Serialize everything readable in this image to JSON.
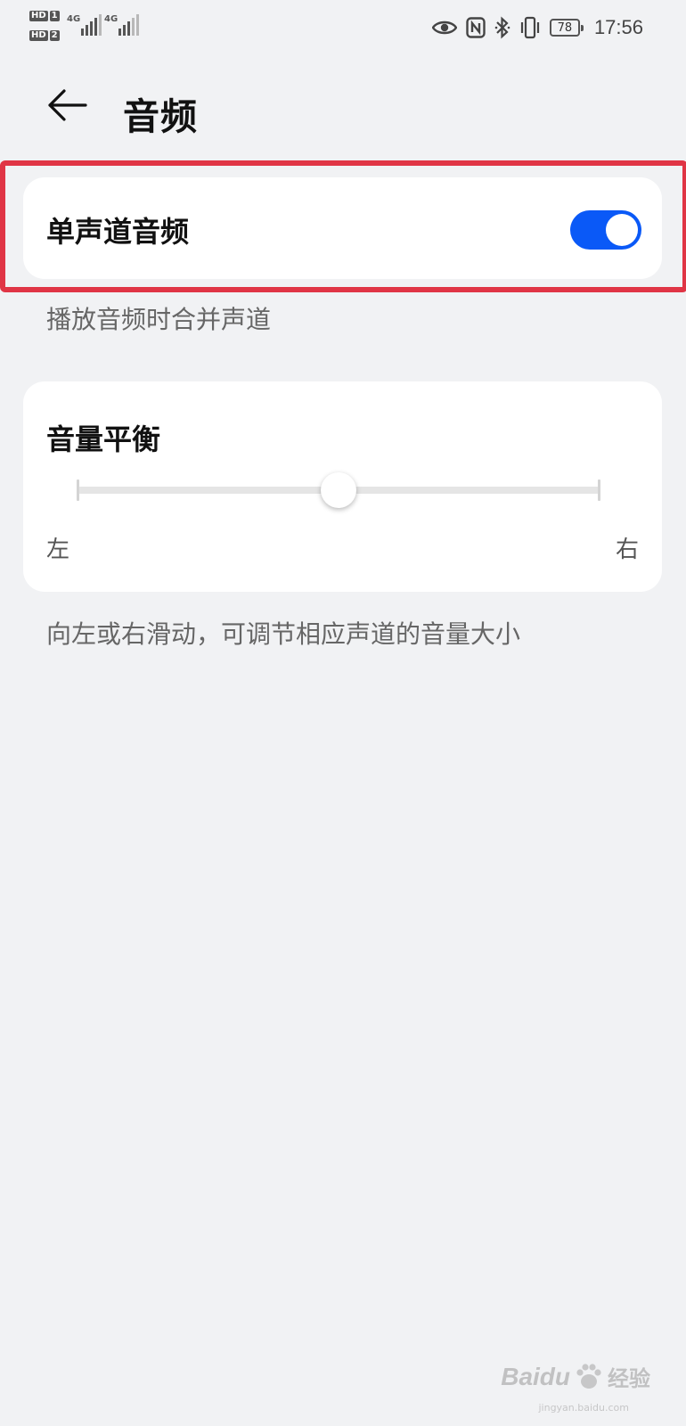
{
  "status_bar": {
    "sim1": {
      "badge": "HD",
      "slot": "1",
      "network": "4G",
      "signal_level": 4
    },
    "sim2": {
      "badge": "HD",
      "slot": "2",
      "network": "4G",
      "signal_level": 3
    },
    "icons": [
      "eye-comfort-icon",
      "nfc-icon",
      "bluetooth-icon",
      "vibrate-icon"
    ],
    "battery_level": "78",
    "time": "17:56"
  },
  "header": {
    "back_icon": "arrow-left-icon",
    "title": "音频"
  },
  "mono_audio": {
    "label": "单声道音频",
    "enabled": true,
    "toggle_color": "#0a59f7",
    "description": "播放音频时合并声道"
  },
  "volume_balance": {
    "title": "音量平衡",
    "left_label": "左",
    "right_label": "右",
    "value": 0.5,
    "description": "向左或右滑动，可调节相应声道的音量大小"
  },
  "highlight_color": "#e03545",
  "watermark": {
    "brand": "Baidu",
    "product": "经验",
    "url": "jingyan.baidu.com"
  }
}
